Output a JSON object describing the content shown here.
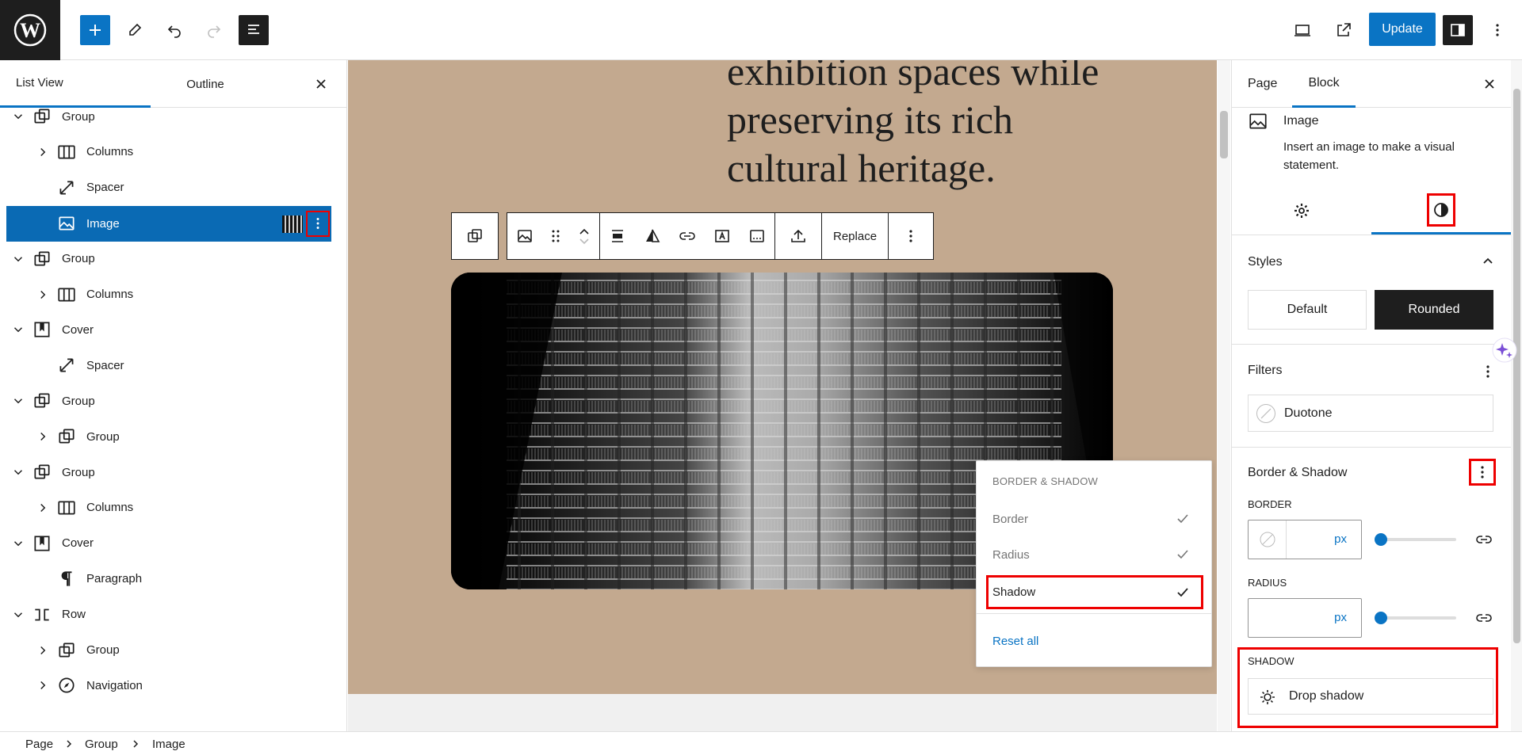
{
  "topbar": {
    "update_label": "Update"
  },
  "left_panel": {
    "tabs": [
      "List View",
      "Outline"
    ],
    "tree": [
      {
        "label": "Group",
        "level": 0,
        "expanded": true,
        "icon": "group-icon"
      },
      {
        "label": "Columns",
        "level": 1,
        "expanded": false,
        "icon": "columns-icon"
      },
      {
        "label": "Spacer",
        "level": 1,
        "expanded": null,
        "icon": "spacer-icon"
      },
      {
        "label": "Image",
        "level": 1,
        "expanded": null,
        "icon": "image-icon",
        "selected": true
      },
      {
        "label": "Group",
        "level": 0,
        "expanded": true,
        "icon": "group-icon"
      },
      {
        "label": "Columns",
        "level": 1,
        "expanded": false,
        "icon": "columns-icon"
      },
      {
        "label": "Cover",
        "level": 0,
        "expanded": true,
        "icon": "cover-icon"
      },
      {
        "label": "Spacer",
        "level": 1,
        "expanded": null,
        "icon": "spacer-icon"
      },
      {
        "label": "Group",
        "level": 0,
        "expanded": true,
        "icon": "group-icon"
      },
      {
        "label": "Group",
        "level": 1,
        "expanded": false,
        "icon": "group-icon"
      },
      {
        "label": "Group",
        "level": 0,
        "expanded": true,
        "icon": "group-icon"
      },
      {
        "label": "Columns",
        "level": 1,
        "expanded": false,
        "icon": "columns-icon"
      },
      {
        "label": "Cover",
        "level": 0,
        "expanded": true,
        "icon": "cover-icon"
      },
      {
        "label": "Paragraph",
        "level": 1,
        "expanded": null,
        "icon": "paragraph-icon"
      },
      {
        "label": "Row",
        "level": 0,
        "expanded": true,
        "icon": "row-icon"
      },
      {
        "label": "Group",
        "level": 1,
        "expanded": false,
        "icon": "group-icon"
      },
      {
        "label": "Navigation",
        "level": 1,
        "expanded": false,
        "icon": "navigation-icon"
      }
    ]
  },
  "canvas": {
    "hero_lines": [
      "exhibition spaces while",
      "preserving its rich",
      "cultural heritage."
    ],
    "toolbar_replace": "Replace",
    "background_color": "#c3a98f"
  },
  "popover": {
    "heading": "BORDER & SHADOW",
    "items": [
      {
        "label": "Border",
        "checked": true
      },
      {
        "label": "Radius",
        "checked": true
      },
      {
        "label": "Shadow",
        "checked": true,
        "highlighted": true
      }
    ],
    "reset_label": "Reset all"
  },
  "sidebar": {
    "tabs": [
      "Page",
      "Block"
    ],
    "block_title": "Image",
    "block_description": "Insert an image to make a visual statement.",
    "styles_heading": "Styles",
    "style_options": [
      "Default",
      "Rounded"
    ],
    "active_style": "Rounded",
    "filters_heading": "Filters",
    "duotone_label": "Duotone",
    "border_shadow_heading": "Border & Shadow",
    "border_label": "BORDER",
    "radius_label": "RADIUS",
    "unit": "px",
    "shadow_label": "SHADOW",
    "drop_shadow_label": "Drop shadow"
  },
  "breadcrumb": [
    "Page",
    "Group",
    "Image"
  ],
  "colors": {
    "accent": "#0a74c4",
    "highlight": "#ee0000",
    "dark": "#1e1e1e"
  }
}
